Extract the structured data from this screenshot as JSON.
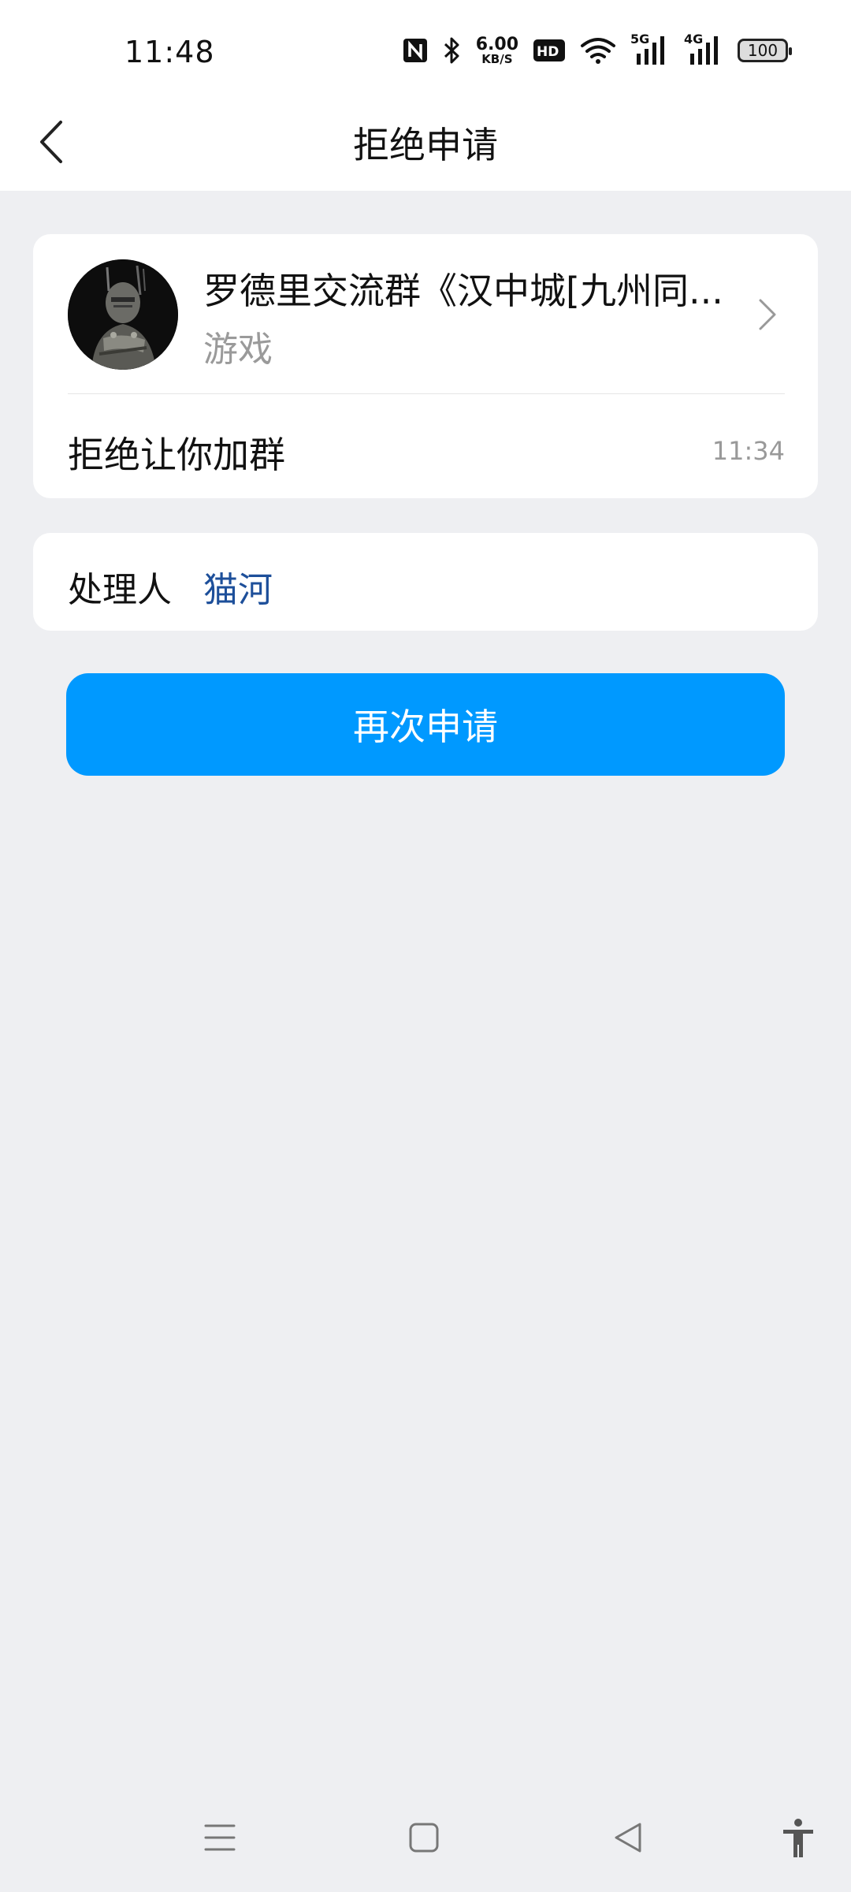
{
  "status_bar": {
    "time": "11:48",
    "net_speed_value": "6.00",
    "net_speed_unit": "KB/S",
    "hd_label": "HD",
    "sig1_label": "5G",
    "sig2_label": "4G",
    "battery": "100",
    "icons": [
      "nfc-icon",
      "bluetooth-icon",
      "hd-icon",
      "wifi-icon",
      "signal-5g-icon",
      "signal-4g-icon",
      "battery-icon"
    ]
  },
  "header": {
    "title": "拒绝申请",
    "back_icon": "chevron-left-icon"
  },
  "group": {
    "name": "罗德里交流群《汉中城[九州同...",
    "category": "游戏",
    "avatar": "knight-avatar"
  },
  "result": {
    "message": "拒绝让你加群",
    "time": "11:34"
  },
  "handler": {
    "label": "处理人",
    "name": "猫河"
  },
  "actions": {
    "reapply_label": "再次申请"
  },
  "nav": {
    "icons": [
      "menu-icon",
      "home-square-icon",
      "back-triangle-icon",
      "accessibility-icon"
    ]
  },
  "colors": {
    "accent": "#0099ff",
    "link": "#1d4f9a",
    "background": "#eeeff2"
  }
}
